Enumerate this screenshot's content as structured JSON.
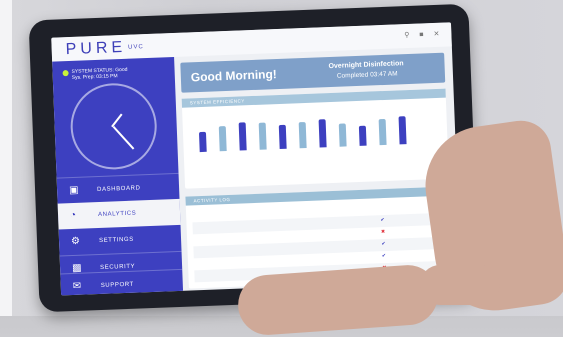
{
  "app": {
    "logo": "PURE",
    "logo_sub": "UVC"
  },
  "window_icons": [
    "search-icon",
    "minimize-icon",
    "close-icon"
  ],
  "status": {
    "line1": "SYSTEM STATUS: Good",
    "line2": "Sys. Prep: 03:15 PM"
  },
  "nav": [
    {
      "label": "DASHBOARD",
      "icon": "monitor-icon",
      "active": false
    },
    {
      "label": "ANALYTICS",
      "icon": "pie-chart-icon",
      "active": true
    },
    {
      "label": "SETTINGS",
      "icon": "gear-icon",
      "active": false
    },
    {
      "label": "SECURITY",
      "icon": "lock-icon",
      "active": false
    },
    {
      "label": "SUPPORT",
      "icon": "mail-icon",
      "active": false
    }
  ],
  "banner": {
    "greeting": "Good Morning!",
    "title": "Overnight Disinfection",
    "subtitle": "Completed 03:47 AM"
  },
  "efficiency": {
    "title": "SYSTEM EFFICIENCY"
  },
  "chart_data": {
    "type": "bar",
    "colors": {
      "dark": "#3d40c0",
      "light": "#8fb8d6"
    },
    "values": [
      62,
      78,
      88,
      84,
      75,
      82,
      88,
      72,
      64,
      80,
      86
    ]
  },
  "activity": {
    "title": "ACTIVITY LOG"
  },
  "accent": "#3d40c0",
  "error_color": "#e0313c",
  "log_results": [
    "check",
    "x",
    "check",
    "check",
    "x",
    "check"
  ]
}
